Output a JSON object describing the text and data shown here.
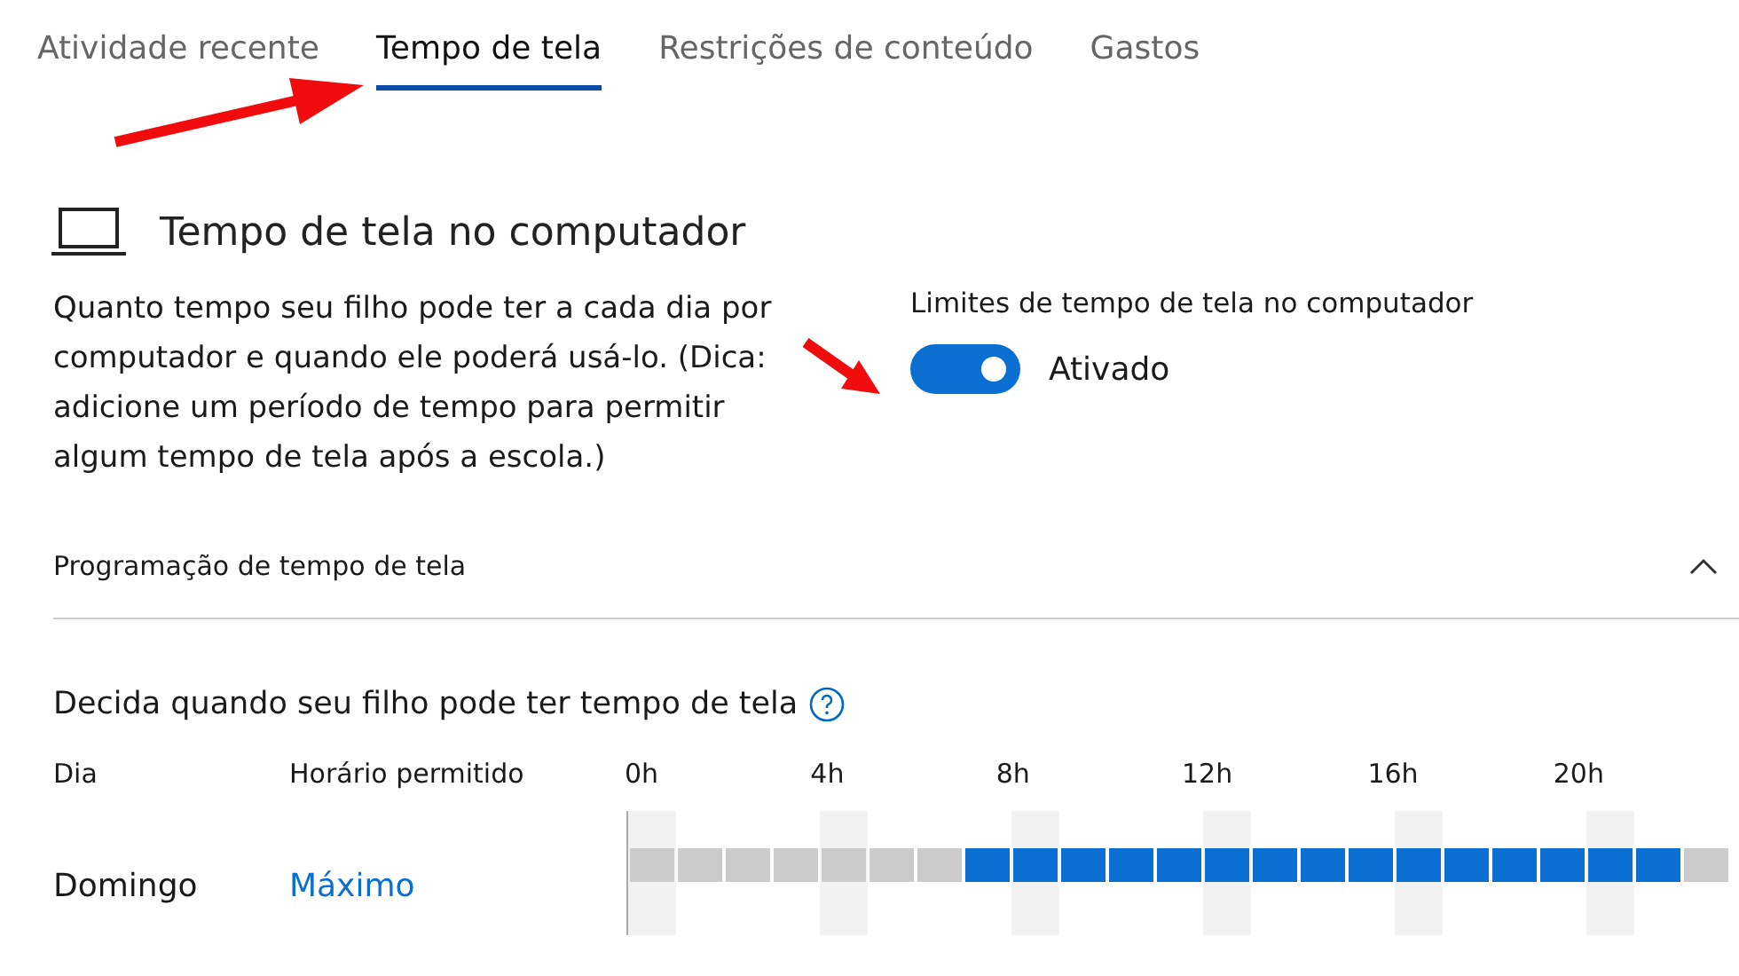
{
  "tabs": [
    {
      "label": "Atividade recente",
      "selected": false
    },
    {
      "label": "Tempo de tela",
      "selected": true
    },
    {
      "label": "Restrições de conteúdo",
      "selected": false
    },
    {
      "label": "Gastos",
      "selected": false
    }
  ],
  "section": {
    "title": "Tempo de tela no computador",
    "description": "Quanto tempo seu filho pode ter a cada dia por computador e quando ele poderá usá-lo. (Dica: adicione um período de tempo para permitir algum tempo de tela após a escola.)",
    "limit_label": "Limites de tempo de tela no computador",
    "limit_on": true,
    "limit_state": "Ativado"
  },
  "schedule": {
    "title": "Programação de tempo de tela",
    "expanded": true,
    "prompt": "Decida quando seu filho pode ter tempo de tela",
    "columns": [
      "Dia",
      "Horário permitido"
    ],
    "ticks": [
      "0h",
      "4h",
      "8h",
      "12h",
      "16h",
      "20h"
    ],
    "rows": [
      {
        "day": "Domingo",
        "allowed_time": "Máximo",
        "slots": [
          {
            "on": false
          },
          {
            "on": false
          },
          {
            "on": false
          },
          {
            "on": false
          },
          {
            "on": false
          },
          {
            "on": false
          },
          {
            "on": false
          },
          {
            "on": true
          },
          {
            "on": true
          },
          {
            "on": true
          },
          {
            "on": true
          },
          {
            "on": true
          },
          {
            "on": true
          },
          {
            "on": true
          },
          {
            "on": true
          },
          {
            "on": true
          },
          {
            "on": true
          },
          {
            "on": true
          },
          {
            "on": true
          },
          {
            "on": true
          },
          {
            "on": true
          },
          {
            "on": true
          },
          {
            "on": false
          }
        ]
      }
    ]
  }
}
